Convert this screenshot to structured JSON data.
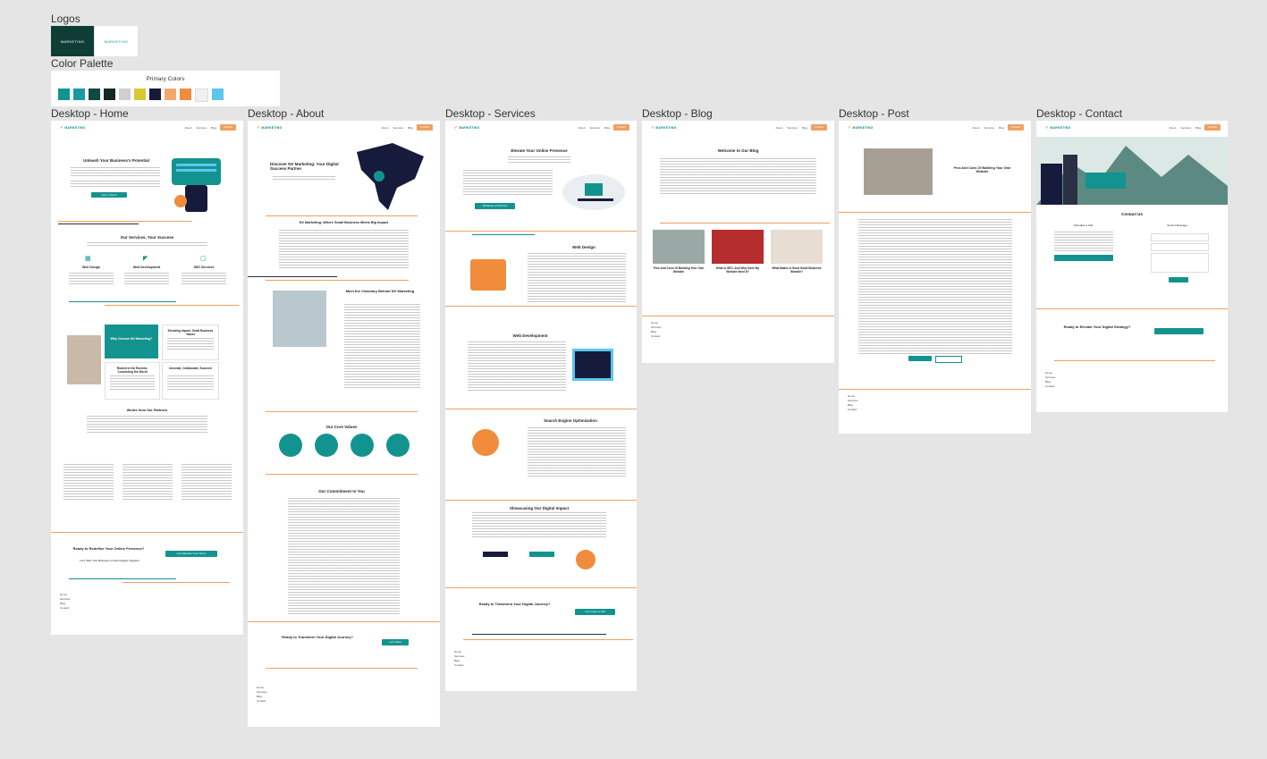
{
  "sections": {
    "logos": "Logos",
    "palette": "Color Palette"
  },
  "palette": {
    "title": "Primary Colors",
    "colors": [
      "#13938f",
      "#1a9aa0",
      "#0e4a44",
      "#132a24",
      "#cfcfcf",
      "#d9c831",
      "#161b3c",
      "#f2a86a",
      "#f08c3c",
      "#f0f0f0",
      "#5bc6ee"
    ]
  },
  "logos": {
    "mark": "MARKETING"
  },
  "frames": {
    "home": "Desktop - Home",
    "about": "Desktop - About",
    "services": "Desktop - Services",
    "blog": "Desktop - Blog",
    "post": "Desktop - Post",
    "contact": "Desktop - Contact"
  },
  "nav": {
    "links": [
      "About",
      "Services",
      "Blog"
    ],
    "cta": "Contact"
  },
  "home": {
    "hero": "Unleash Your Business's Potential",
    "hero_btn": "Get in Touch",
    "services_title": "Our Services, Your Success",
    "services": [
      "Web Design",
      "Web Development",
      "SEO Services"
    ],
    "why": "Why Choose NV Marketing?",
    "why_cards": [
      "Elevating Impact, Small Business Values",
      "Rooted in the Rockies, Connecting the World",
      "Innovate, Collaborate, Succeed"
    ],
    "partners": "Words from Our Partners",
    "cta": "Ready to Redefine Your Online Presence?",
    "cta_btn": "Let's Elevate Your Vision",
    "cta_sub": "Let's Take Your Business to New Heights Together"
  },
  "about": {
    "hero": "Discover NV Marketing: Your Digital Success Partner",
    "mission": "NV Marketing: Where Small Business Meets Big Impact",
    "visionary": "Meet the Visionary Behind NV Marketing",
    "values": "Our Core Values",
    "commitment": "Our Commitment to You",
    "cta": "Ready to Transform Your Digital Journey?",
    "cta_btn": "Let's Start"
  },
  "services": {
    "hero": "Elevate Your Online Presence",
    "hero_btn": "Schedule a Call Now",
    "items": [
      "Web Design",
      "Web Development",
      "Search Engine Optimization"
    ],
    "showcase": "Showcasing Our Digital Impact",
    "cta": "Ready to Transform Your Digital Journey?",
    "cta_btn": "Let's Have a Call"
  },
  "blog": {
    "title": "Welcome to Our Blog",
    "posts": [
      "Pros And Cons Of Building Your Own Website",
      "What Is SEO, And Why Does My Website Need It?",
      "What Makes A Good Small Business Website?"
    ]
  },
  "post": {
    "title": "Pros And Cons Of Building Your Own Website"
  },
  "contact": {
    "title": "Contact Us",
    "schedule": "Schedule A Call",
    "send": "Send A Message",
    "cta": "Ready to Elevate Your Digital Strategy?"
  },
  "footer": {
    "links": [
      "Home",
      "Services",
      "Blog",
      "Contact"
    ]
  }
}
